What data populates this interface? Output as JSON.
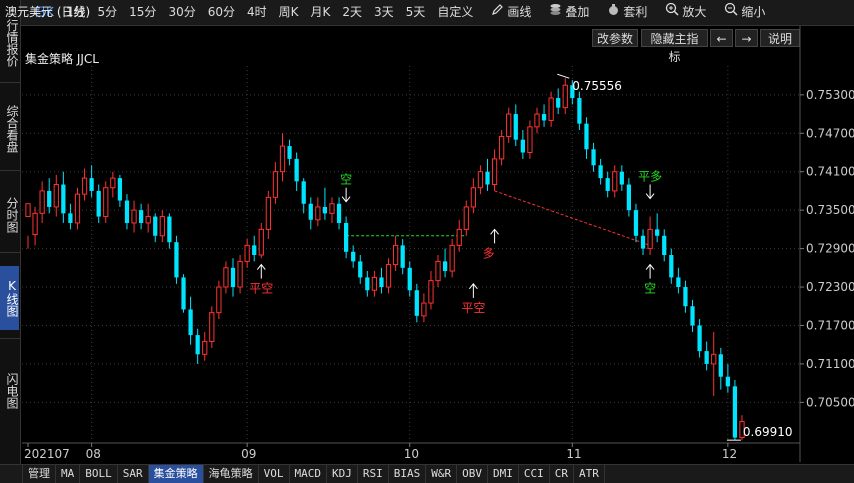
{
  "toolbar": {
    "period_buttons": [
      "日K",
      "1分",
      "5分",
      "15分",
      "30分",
      "60分",
      "4时",
      "周K",
      "月K",
      "2天",
      "3天",
      "5天",
      "自定义"
    ],
    "active_period": "日K",
    "tools": [
      {
        "label": "画线",
        "icon": "pencil-icon"
      },
      {
        "label": "叠加",
        "icon": "stack-icon"
      },
      {
        "label": "套利",
        "icon": "bag-icon"
      },
      {
        "label": "放大",
        "icon": "zoom-in-icon"
      },
      {
        "label": "缩小",
        "icon": "zoom-out-icon"
      }
    ]
  },
  "left_tabs": [
    "行情报价",
    "综合看盘",
    "分时图",
    "K线图",
    "闪电图"
  ],
  "active_left_tab": "K线图",
  "header": {
    "title": "澳元美元 (日线)",
    "strategy": "集金策略 JJCL",
    "buttons": [
      "改参数",
      "隐藏主指标",
      "←",
      "→",
      "说明"
    ]
  },
  "bottom_tabs": [
    "管理",
    "MA",
    "BOLL",
    "SAR",
    "集金策略",
    "海龟策略",
    "VOL",
    "MACD",
    "KDJ",
    "RSI",
    "BIAS",
    "W&R",
    "OBV",
    "DMI",
    "CCI",
    "CR",
    "ATR"
  ],
  "active_bottom_tab": "集金策略",
  "colors": {
    "up": "#ff3232",
    "down": "#00e5ff",
    "buy": "#ff3232",
    "sell": "#22dd22",
    "text": "#dddddd",
    "grid": "#3a3a3a"
  },
  "chart_data": {
    "type": "candlestick",
    "y_ticks": [
      "0.75300",
      "0.74700",
      "0.74100",
      "0.73500",
      "0.72900",
      "0.72300",
      "0.71700",
      "0.71100",
      "0.70500"
    ],
    "ylim": [
      0.6985,
      0.7575
    ],
    "x_ticks": [
      "202107",
      "08",
      "09",
      "10",
      "11",
      "12"
    ],
    "x_tick_index": [
      0,
      9,
      31,
      54,
      77,
      99
    ],
    "high_label": "0.75556",
    "low_label": "0.69910",
    "candles": [
      [
        0.734,
        0.736,
        0.731,
        0.729
      ],
      [
        0.7312,
        0.7345,
        0.7355,
        0.7295
      ],
      [
        0.7345,
        0.738,
        0.7395,
        0.733
      ],
      [
        0.738,
        0.7355,
        0.74,
        0.7345
      ],
      [
        0.7355,
        0.739,
        0.7405,
        0.734
      ],
      [
        0.739,
        0.7345,
        0.741,
        0.733
      ],
      [
        0.7345,
        0.733,
        0.736,
        0.732
      ],
      [
        0.733,
        0.7375,
        0.7385,
        0.732
      ],
      [
        0.7375,
        0.74,
        0.7415,
        0.7365
      ],
      [
        0.74,
        0.738,
        0.742,
        0.737
      ],
      [
        0.738,
        0.734,
        0.739,
        0.733
      ],
      [
        0.734,
        0.7385,
        0.7395,
        0.733
      ],
      [
        0.7385,
        0.74,
        0.741,
        0.737
      ],
      [
        0.74,
        0.7365,
        0.7405,
        0.7355
      ],
      [
        0.7365,
        0.733,
        0.7375,
        0.732
      ],
      [
        0.733,
        0.735,
        0.7365,
        0.7315
      ],
      [
        0.735,
        0.733,
        0.736,
        0.732
      ],
      [
        0.733,
        0.734,
        0.736,
        0.7315
      ],
      [
        0.734,
        0.731,
        0.7345,
        0.73
      ],
      [
        0.731,
        0.734,
        0.735,
        0.73
      ],
      [
        0.734,
        0.73,
        0.7345,
        0.729
      ],
      [
        0.73,
        0.7245,
        0.731,
        0.7235
      ],
      [
        0.7245,
        0.7195,
        0.725,
        0.719
      ],
      [
        0.7195,
        0.7155,
        0.7215,
        0.714
      ],
      [
        0.7155,
        0.7125,
        0.7165,
        0.711
      ],
      [
        0.7125,
        0.7145,
        0.716,
        0.7115
      ],
      [
        0.7145,
        0.719,
        0.72,
        0.7135
      ],
      [
        0.719,
        0.723,
        0.724,
        0.718
      ],
      [
        0.723,
        0.726,
        0.727,
        0.722
      ],
      [
        0.726,
        0.723,
        0.7275,
        0.7215
      ],
      [
        0.723,
        0.727,
        0.728,
        0.722
      ],
      [
        0.727,
        0.7295,
        0.7305,
        0.726
      ],
      [
        0.7295,
        0.728,
        0.731,
        0.727
      ],
      [
        0.728,
        0.732,
        0.733,
        0.7275
      ],
      [
        0.732,
        0.737,
        0.738,
        0.7305
      ],
      [
        0.737,
        0.741,
        0.7425,
        0.736
      ],
      [
        0.741,
        0.745,
        0.747,
        0.7395
      ],
      [
        0.745,
        0.743,
        0.746,
        0.742
      ],
      [
        0.743,
        0.7395,
        0.744,
        0.738
      ],
      [
        0.7395,
        0.736,
        0.74,
        0.7345
      ],
      [
        0.736,
        0.7335,
        0.737,
        0.732
      ],
      [
        0.7335,
        0.7355,
        0.737,
        0.7325
      ],
      [
        0.7355,
        0.7345,
        0.7385,
        0.7335
      ],
      [
        0.7345,
        0.736,
        0.737,
        0.733
      ],
      [
        0.736,
        0.733,
        0.737,
        0.732
      ],
      [
        0.733,
        0.7285,
        0.734,
        0.7275
      ],
      [
        0.7285,
        0.727,
        0.7295,
        0.726
      ],
      [
        0.727,
        0.7245,
        0.728,
        0.7235
      ],
      [
        0.7245,
        0.7225,
        0.7255,
        0.7215
      ],
      [
        0.7225,
        0.7245,
        0.7255,
        0.7215
      ],
      [
        0.7245,
        0.723,
        0.726,
        0.722
      ],
      [
        0.723,
        0.7265,
        0.7275,
        0.722
      ],
      [
        0.7265,
        0.7295,
        0.731,
        0.7255
      ],
      [
        0.7295,
        0.726,
        0.7305,
        0.725
      ],
      [
        0.726,
        0.7225,
        0.727,
        0.7215
      ],
      [
        0.7225,
        0.7185,
        0.7235,
        0.7175
      ],
      [
        0.7185,
        0.7205,
        0.722,
        0.7175
      ],
      [
        0.7205,
        0.724,
        0.7255,
        0.7195
      ],
      [
        0.724,
        0.727,
        0.728,
        0.723
      ],
      [
        0.727,
        0.7255,
        0.729,
        0.7245
      ],
      [
        0.7255,
        0.7295,
        0.7305,
        0.7245
      ],
      [
        0.7295,
        0.732,
        0.7335,
        0.7285
      ],
      [
        0.732,
        0.7355,
        0.7365,
        0.731
      ],
      [
        0.7355,
        0.7385,
        0.74,
        0.7345
      ],
      [
        0.7385,
        0.741,
        0.742,
        0.7375
      ],
      [
        0.741,
        0.739,
        0.743,
        0.738
      ],
      [
        0.739,
        0.743,
        0.7445,
        0.738
      ],
      [
        0.743,
        0.7465,
        0.7475,
        0.742
      ],
      [
        0.7465,
        0.75,
        0.751,
        0.7455
      ],
      [
        0.75,
        0.746,
        0.7515,
        0.745
      ],
      [
        0.746,
        0.744,
        0.7475,
        0.743
      ],
      [
        0.744,
        0.748,
        0.749,
        0.743
      ],
      [
        0.748,
        0.75,
        0.751,
        0.747
      ],
      [
        0.75,
        0.749,
        0.7515,
        0.748
      ],
      [
        0.749,
        0.7525,
        0.7535,
        0.748
      ],
      [
        0.7525,
        0.751,
        0.754,
        0.75
      ],
      [
        0.751,
        0.7545,
        0.7556,
        0.75
      ],
      [
        0.7545,
        0.7525,
        0.7553,
        0.7515
      ],
      [
        0.7525,
        0.7485,
        0.7535,
        0.7475
      ],
      [
        0.7485,
        0.7445,
        0.7495,
        0.743
      ],
      [
        0.7445,
        0.742,
        0.7455,
        0.741
      ],
      [
        0.742,
        0.74,
        0.743,
        0.739
      ],
      [
        0.74,
        0.738,
        0.741,
        0.737
      ],
      [
        0.738,
        0.741,
        0.742,
        0.737
      ],
      [
        0.741,
        0.739,
        0.742,
        0.738
      ],
      [
        0.739,
        0.735,
        0.74,
        0.734
      ],
      [
        0.735,
        0.731,
        0.736,
        0.73
      ],
      [
        0.731,
        0.729,
        0.732,
        0.728
      ],
      [
        0.729,
        0.732,
        0.734,
        0.728
      ],
      [
        0.732,
        0.731,
        0.7345,
        0.73
      ],
      [
        0.731,
        0.728,
        0.732,
        0.727
      ],
      [
        0.728,
        0.7245,
        0.729,
        0.7235
      ],
      [
        0.7245,
        0.723,
        0.726,
        0.722
      ],
      [
        0.723,
        0.72,
        0.724,
        0.719
      ],
      [
        0.72,
        0.717,
        0.721,
        0.716
      ],
      [
        0.717,
        0.713,
        0.718,
        0.712
      ],
      [
        0.713,
        0.711,
        0.7145,
        0.71
      ],
      [
        0.711,
        0.7125,
        0.716,
        0.706
      ],
      [
        0.7125,
        0.709,
        0.7135,
        0.707
      ],
      [
        0.709,
        0.7075,
        0.711,
        0.7065
      ],
      [
        0.7075,
        0.6995,
        0.7085,
        0.6991
      ],
      [
        0.6995,
        0.702,
        0.703,
        0.6991
      ]
    ],
    "signals": [
      {
        "label": "平空",
        "index": 33,
        "type": "buy",
        "price": 0.7265
      },
      {
        "label": "空",
        "index": 45,
        "type": "sell",
        "price": 0.736
      },
      {
        "label": "平空",
        "index": 63,
        "type": "buy",
        "price": 0.7235
      },
      {
        "label": "多",
        "index": 66,
        "type": "buy",
        "price": 0.732
      },
      {
        "label": "平多",
        "index": 88,
        "type": "sell",
        "price": 0.7365
      },
      {
        "label": "空",
        "index": 88,
        "type": "sell-below",
        "price": 0.7265
      }
    ],
    "trade_lines": [
      {
        "from": 45,
        "to": 62,
        "price": 0.731,
        "color": "#22dd22"
      },
      {
        "from": 66,
        "to": 88,
        "from_price": 0.738,
        "to_price": 0.7295,
        "color": "#ff3232"
      }
    ]
  }
}
